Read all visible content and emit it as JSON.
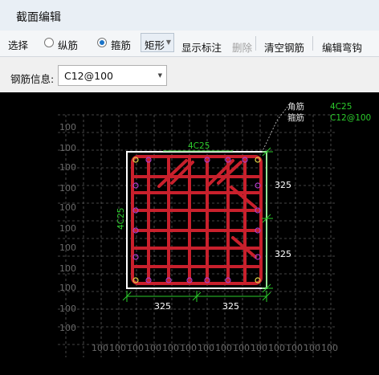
{
  "window": {
    "title": "截面编辑"
  },
  "toolbar": {
    "select_label": "选择",
    "longitudinal_label": "纵筋",
    "stirrup_label": "箍筋",
    "shape_label": "矩形",
    "show_annotation_label": "显示标注",
    "delete_label": "删除",
    "clear_rebar_label": "清空钢筋",
    "edit_hook_label": "编辑弯钩",
    "selected_mode": "stirrup"
  },
  "rebar_info": {
    "label": "钢筋信息:",
    "value": "C12@100"
  },
  "drawing": {
    "legend": {
      "corner_label": "角筋",
      "corner_value": "4C25",
      "stirrup_label": "箍筋",
      "stirrup_value": "C12@100"
    },
    "top_label": "4C25",
    "left_label": "4C25",
    "right_dims": [
      "325",
      "325"
    ],
    "bottom_dims": [
      "325",
      "325"
    ],
    "grid_label": "100",
    "colors": {
      "rebar": "#c8202c",
      "section": "#ffffff",
      "dimension": "#2ccb2c",
      "grid": "#5a5a5a",
      "legend": "#2ccb2c"
    }
  }
}
